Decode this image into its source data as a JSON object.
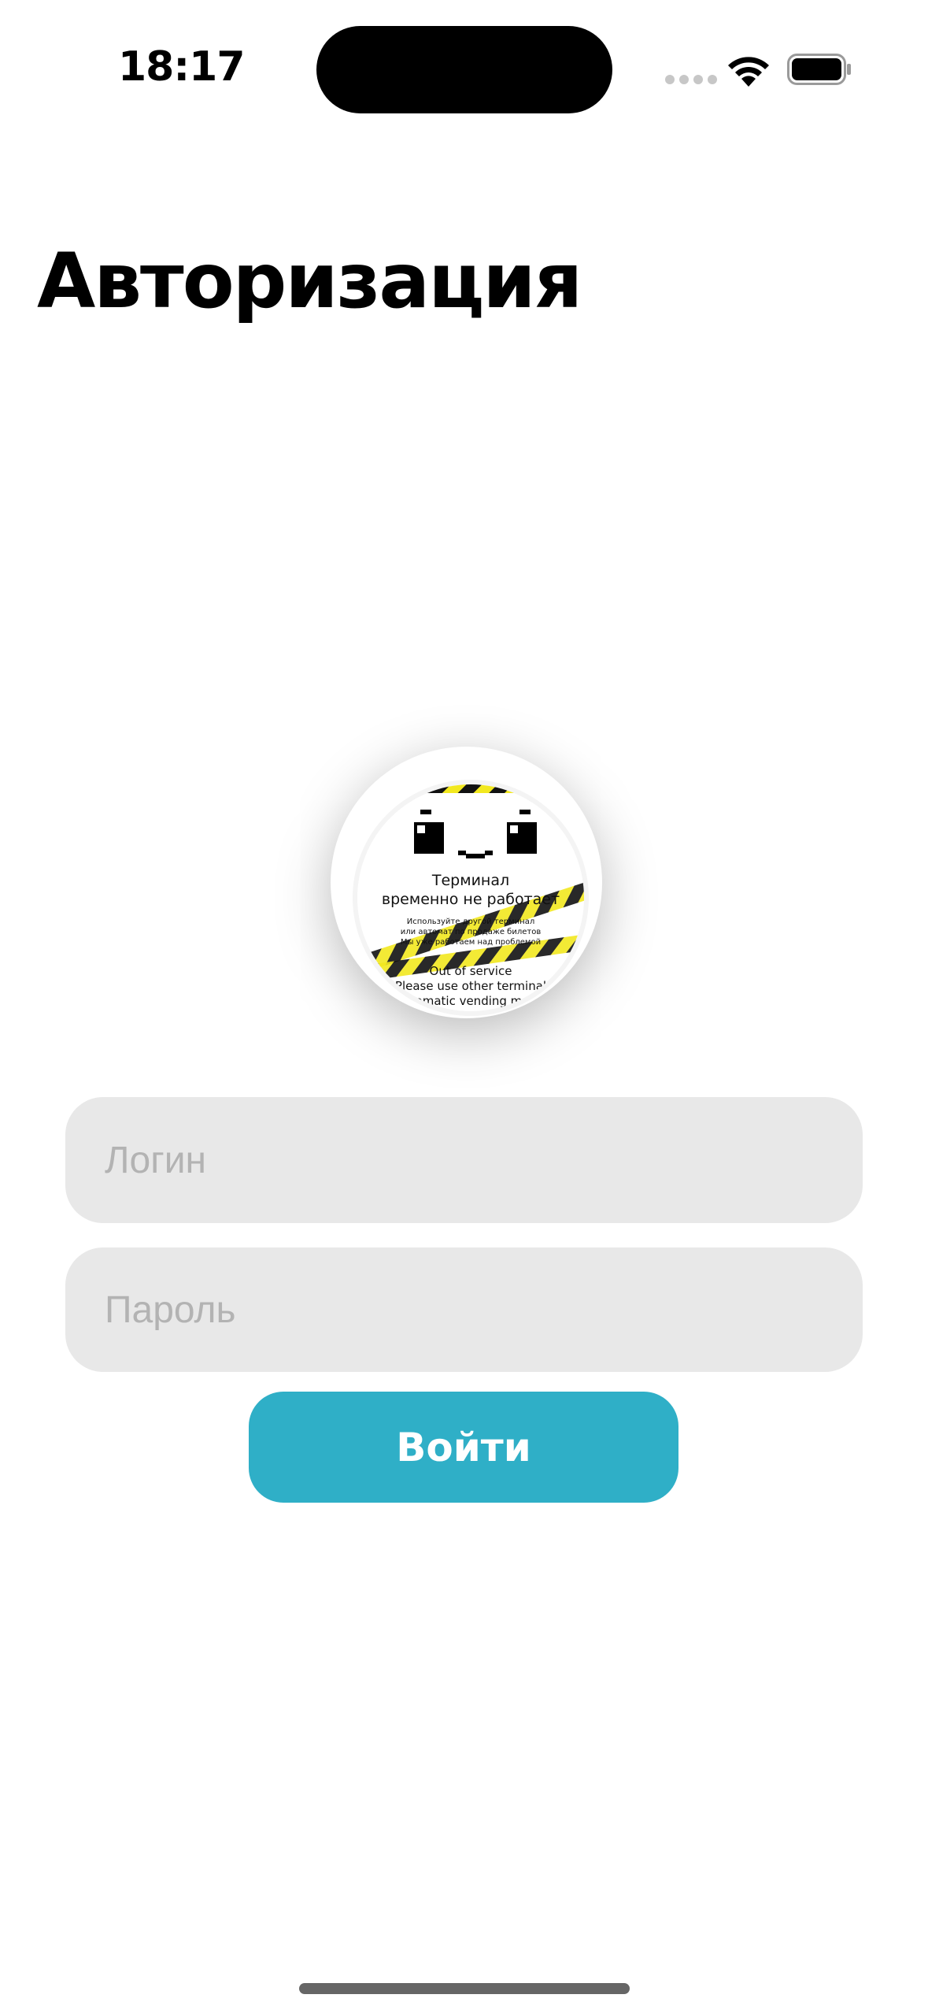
{
  "status_bar": {
    "time": "18:17",
    "icons": [
      "signal-dots-icon",
      "wifi-icon",
      "battery-icon"
    ]
  },
  "page": {
    "title": "Авторизация"
  },
  "badge_image": {
    "title_line1": "Терминал",
    "title_line2": "временно не работает",
    "small_line1": "Используйте другой терминал",
    "small_line2": "или автомат по продаже билетов",
    "small_line3": "Мы уже работаем над проблемой",
    "en_line1": "Out of service",
    "en_line2": "Please use other terminal",
    "en_line3": "or automatic vending machine",
    "colors": {
      "tape_yellow": "#f2e81f",
      "tape_black": "#111111"
    }
  },
  "form": {
    "login_placeholder": "Логин",
    "password_placeholder": "Пароль",
    "submit_label": "Войти"
  },
  "colors": {
    "accent": "#2fafc7",
    "field_background": "#e8e8e8",
    "placeholder": "#b3b3b3"
  }
}
